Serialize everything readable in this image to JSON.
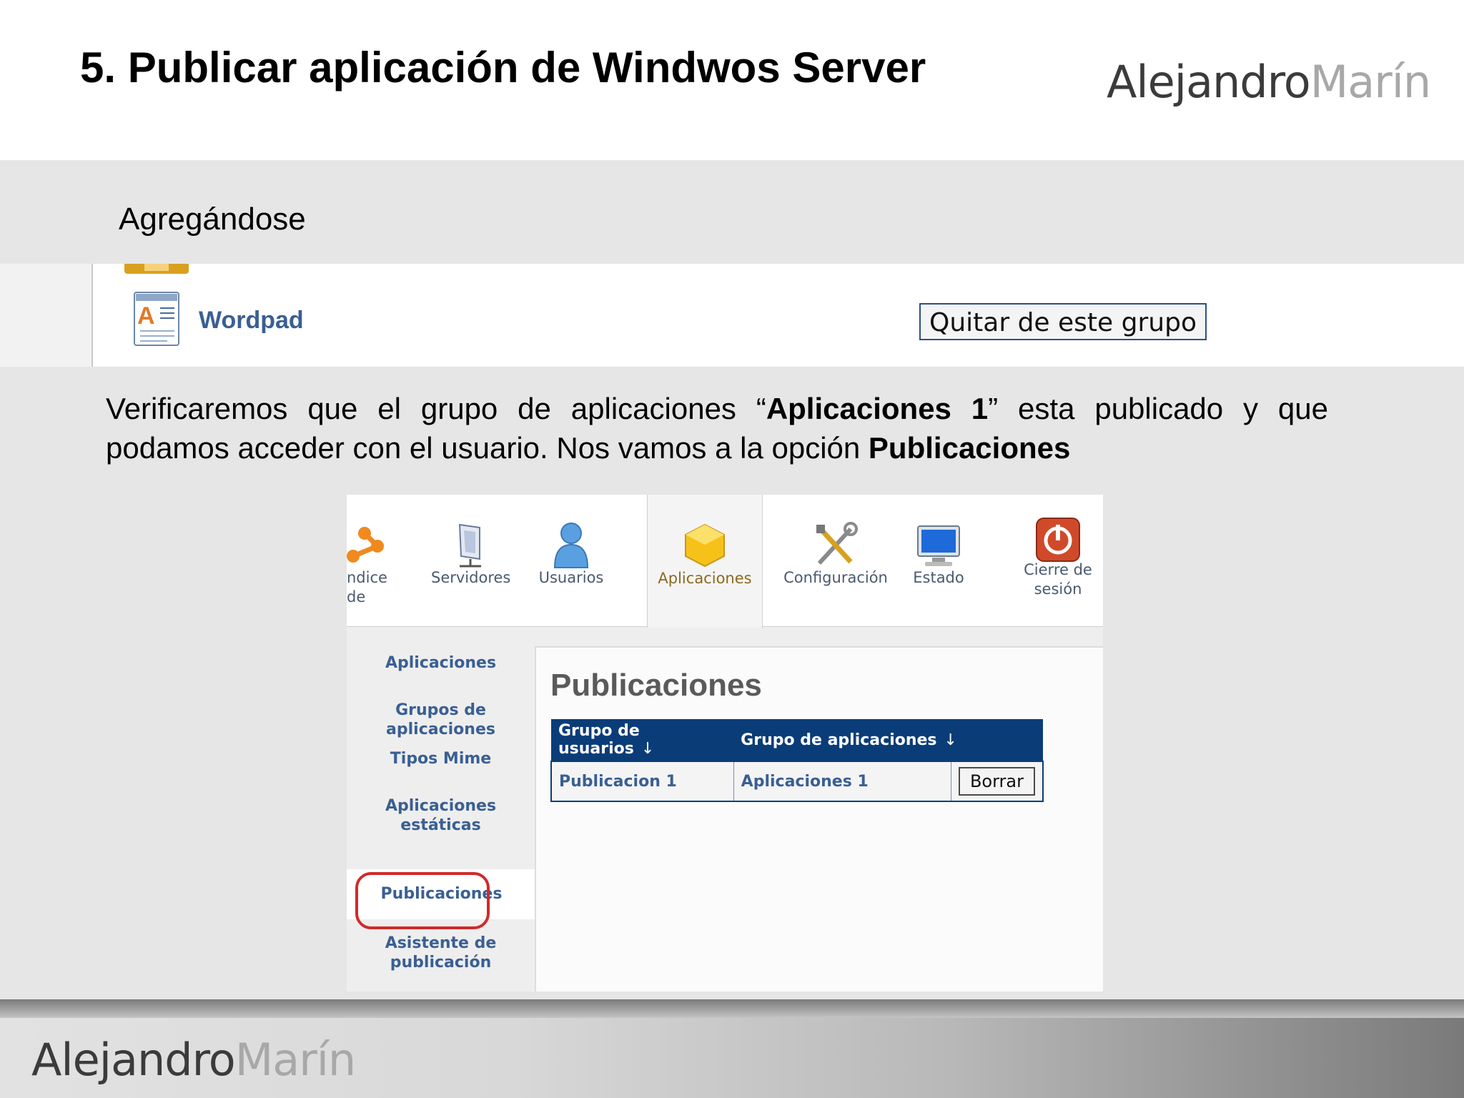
{
  "slide": {
    "title": "5. Publicar aplicación de Windwos Server",
    "logo_first": "Alejandro",
    "logo_last": "Marín",
    "subtitle": "Agregándose"
  },
  "group_strip": {
    "app_label": "Wordpad",
    "remove_button": "Quitar de este grupo"
  },
  "paragraph": {
    "part1": "Verificaremos que el grupo de aplicaciones “",
    "bold1": "Aplicaciones 1",
    "part2": "” esta publicado y que podamos acceder con el usuario. Nos vamos a la opción ",
    "bold2": "Publicaciones"
  },
  "screenshot": {
    "top_nav": [
      {
        "label": "ndice de",
        "icon": "index-icon"
      },
      {
        "label": "Servidores",
        "icon": "server-icon"
      },
      {
        "label": "Usuarios",
        "icon": "user-icon"
      },
      {
        "label": "Aplicaciones",
        "icon": "applications-icon"
      },
      {
        "label": "Configuración",
        "icon": "tools-icon"
      },
      {
        "label": "Estado",
        "icon": "monitor-icon"
      },
      {
        "label": "Cierre de sesión",
        "icon": "power-icon"
      }
    ],
    "side_nav": [
      "Aplicaciones",
      "Grupos de aplicaciones",
      "Tipos Mime",
      "Aplicaciones estáticas",
      "Publicaciones",
      "Asistente de publicación"
    ],
    "content_title": "Publicaciones",
    "table": {
      "headers": [
        "Grupo de usuarios",
        "Grupo de aplicaciones"
      ],
      "sort_arrow": "↓",
      "rows": [
        {
          "user_group": "Publicacion 1",
          "app_group": "Aplicaciones 1",
          "action": "Borrar"
        }
      ]
    }
  },
  "colors": {
    "table_header": "#0a3d78",
    "link_blue": "#3a5f93",
    "highlight_red": "#d12a2a"
  }
}
